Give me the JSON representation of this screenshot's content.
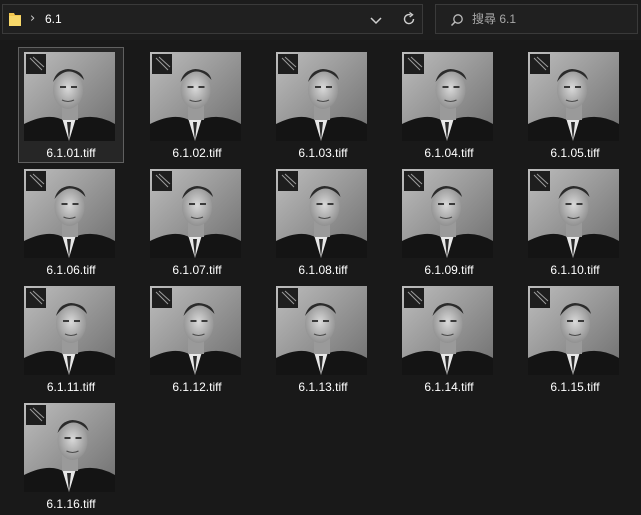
{
  "address_bar": {
    "folder_icon": "folder-icon",
    "separator": "›",
    "path": "6.1",
    "dropdown_icon": "chevron-down-icon",
    "refresh_icon": "refresh-icon"
  },
  "search": {
    "icon": "search-icon",
    "placeholder": "搜尋 6.1"
  },
  "files": [
    {
      "name": "6.1.01.tiff",
      "selected": true
    },
    {
      "name": "6.1.02.tiff"
    },
    {
      "name": "6.1.03.tiff"
    },
    {
      "name": "6.1.04.tiff"
    },
    {
      "name": "6.1.05.tiff"
    },
    {
      "name": "6.1.06.tiff"
    },
    {
      "name": "6.1.07.tiff"
    },
    {
      "name": "6.1.08.tiff"
    },
    {
      "name": "6.1.09.tiff"
    },
    {
      "name": "6.1.10.tiff"
    },
    {
      "name": "6.1.11.tiff"
    },
    {
      "name": "6.1.12.tiff"
    },
    {
      "name": "6.1.13.tiff"
    },
    {
      "name": "6.1.14.tiff"
    },
    {
      "name": "6.1.15.tiff"
    },
    {
      "name": "6.1.16.tiff"
    }
  ]
}
